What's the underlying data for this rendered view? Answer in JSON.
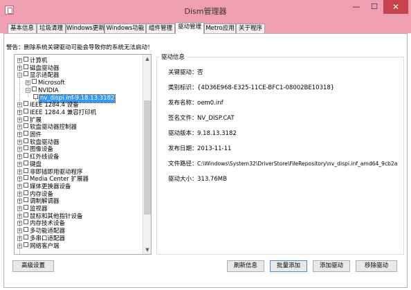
{
  "window": {
    "title": "Dism管理器",
    "minimize_glyph": "—",
    "maximize_glyph": "☐",
    "close_glyph": "✕"
  },
  "tabs": [
    {
      "label": "基本信息",
      "active": false
    },
    {
      "label": "垃圾清理",
      "active": false
    },
    {
      "label": "Windows更新",
      "active": false
    },
    {
      "label": "Windows功能",
      "active": false
    },
    {
      "label": "组件管理",
      "active": false
    },
    {
      "label": "驱动管理",
      "active": true
    },
    {
      "label": "Metro应用",
      "active": false
    },
    {
      "label": "关于程序",
      "active": false
    }
  ],
  "warning": "警告：删除系统关键驱动可能会导致你的系统无法启动！",
  "tree": {
    "items": [
      {
        "label": "计算机",
        "depth": 0,
        "expander": "+"
      },
      {
        "label": "磁盘驱动器",
        "depth": 0,
        "expander": "+"
      },
      {
        "label": "显示适配器",
        "depth": 0,
        "expander": "−"
      },
      {
        "label": "Microsoft",
        "depth": 1,
        "expander": "+"
      },
      {
        "label": "NVIDIA",
        "depth": 1,
        "expander": "−"
      },
      {
        "label": "nv_dispi.inf-9.18.13.3182",
        "depth": 2,
        "expander": "",
        "selected": true
      },
      {
        "label": "IEEE 1284.4 设备",
        "depth": 0,
        "expander": "+"
      },
      {
        "label": "IEEE 1284.4 兼容打印机",
        "depth": 0,
        "expander": "+"
      },
      {
        "label": "扩展",
        "depth": 0,
        "expander": "+"
      },
      {
        "label": "软盘驱动器控制器",
        "depth": 0,
        "expander": "+"
      },
      {
        "label": "固件",
        "depth": 0,
        "expander": "+"
      },
      {
        "label": "软盘驱动器",
        "depth": 0,
        "expander": "+"
      },
      {
        "label": "图像设备",
        "depth": 0,
        "expander": "+"
      },
      {
        "label": "红外线设备",
        "depth": 0,
        "expander": "+"
      },
      {
        "label": "键盘",
        "depth": 0,
        "expander": "+"
      },
      {
        "label": "非即插即用驱动程序",
        "depth": 0,
        "expander": "+"
      },
      {
        "label": "Media Center 扩展器",
        "depth": 0,
        "expander": "+"
      },
      {
        "label": "媒体更换器设备",
        "depth": 0,
        "expander": "+"
      },
      {
        "label": "内存设备",
        "depth": 0,
        "expander": "+"
      },
      {
        "label": "调制解调器",
        "depth": 0,
        "expander": "+"
      },
      {
        "label": "监视器",
        "depth": 0,
        "expander": "+"
      },
      {
        "label": "鼠标和其他指针设备",
        "depth": 0,
        "expander": "+"
      },
      {
        "label": "内存技术设备",
        "depth": 0,
        "expander": "+"
      },
      {
        "label": "多功能适配器",
        "depth": 0,
        "expander": "+"
      },
      {
        "label": "多串口适配器",
        "depth": 0,
        "expander": "+"
      },
      {
        "label": "网络客户端",
        "depth": 0,
        "expander": "+"
      }
    ],
    "scroll_up_glyph": "▲",
    "scroll_down_glyph": "▼"
  },
  "driver_info": {
    "title": "驱动信息",
    "fields": [
      {
        "label": "关键驱动：",
        "value": "否"
      },
      {
        "label": "类别标识：",
        "value": "{4D36E968-E325-11CE-BFC1-08002BE10318}"
      },
      {
        "label": "发布名称：",
        "value": "oem0.inf"
      },
      {
        "label": "签名文件：",
        "value": "NV_DISP.CAT"
      },
      {
        "label": "驱动版本：",
        "value": "9.18.13.3182"
      },
      {
        "label": "发布日期：",
        "value": "2013-11-11"
      },
      {
        "label": "文件路径：",
        "value": "C:\\Windows\\System32\\DriverStore\\FileRepository\\nv_dispi.inf_amd64_9cb2a"
      },
      {
        "label": "驱动大小：",
        "value": "313.76MB"
      }
    ]
  },
  "buttons": {
    "advanced": "高级设置",
    "refresh": "刷新信息",
    "batch_add": "批量添加",
    "add_driver": "添加驱动",
    "remove_driver": "移除驱动"
  },
  "colors": {
    "titlebar": "#ef9fb0",
    "close_button": "#c7424f",
    "selection": "#3399ff"
  }
}
